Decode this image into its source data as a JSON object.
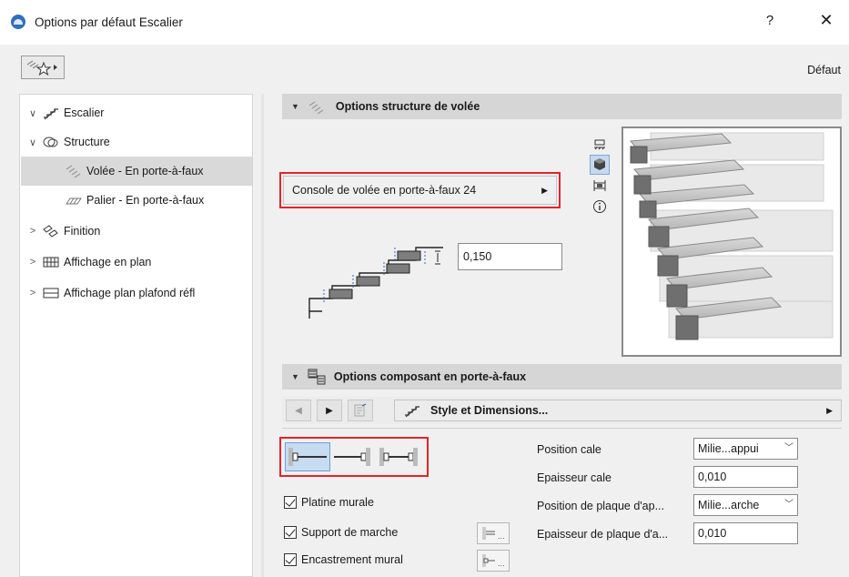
{
  "window": {
    "title": "Options par défaut Escalier",
    "help_label": "?",
    "close_label": "✕"
  },
  "topbar": {
    "default_label": "Défaut"
  },
  "tree": {
    "items": [
      {
        "chevron": "∨",
        "label": "Escalier",
        "icon": "stair-icon"
      },
      {
        "chevron": "∨",
        "label": "Structure",
        "icon": "structure-icon"
      },
      {
        "chevron": "",
        "label": "Volée - En porte-à-faux",
        "icon": "flight-icon",
        "selected": true
      },
      {
        "chevron": "",
        "label": "Palier - En porte-à-faux",
        "icon": "landing-icon"
      },
      {
        "chevron": ">",
        "label": "Finition",
        "icon": "finish-icon"
      },
      {
        "chevron": ">",
        "label": "Affichage en plan",
        "icon": "plan-display-icon"
      },
      {
        "chevron": ">",
        "label": "Affichage plan plafond réfl",
        "icon": "ceiling-plan-icon"
      }
    ]
  },
  "section1": {
    "title": "Options structure de volée"
  },
  "structure_select": {
    "value": "Console de volée en porte-à-faux 24",
    "arrow": "▶"
  },
  "thickness": {
    "value": "0,150"
  },
  "view_icons": [
    "floor-plan-icon",
    "3d-view-icon",
    "section-view-icon",
    "info-icon"
  ],
  "section2": {
    "title": "Options composant en porte-à-faux"
  },
  "toolbar2": {
    "prev": "◀",
    "next": "▶",
    "style_label": "Style et Dimensions...",
    "style_arrow": "▶"
  },
  "checkboxes": [
    {
      "label": "Platine murale",
      "checked": true
    },
    {
      "label": "Support de marche",
      "checked": true
    },
    {
      "label": "Encastrement mural",
      "checked": true
    }
  ],
  "fields": {
    "position_cale": {
      "label": "Position cale",
      "value": "Milie...appui"
    },
    "epaisseur_cale": {
      "label": "Epaisseur cale",
      "value": "0,010"
    },
    "position_plaque": {
      "label": "Position de plaque d'ap...",
      "value": "Milie...arche"
    },
    "epaisseur_plaque": {
      "label": "Epaisseur de plaque d'a...",
      "value": "0,010"
    }
  },
  "colors": {
    "highlight_red": "#e3242b",
    "selection_blue": "#c7dbf1",
    "header_gray": "#d6d6d6"
  }
}
